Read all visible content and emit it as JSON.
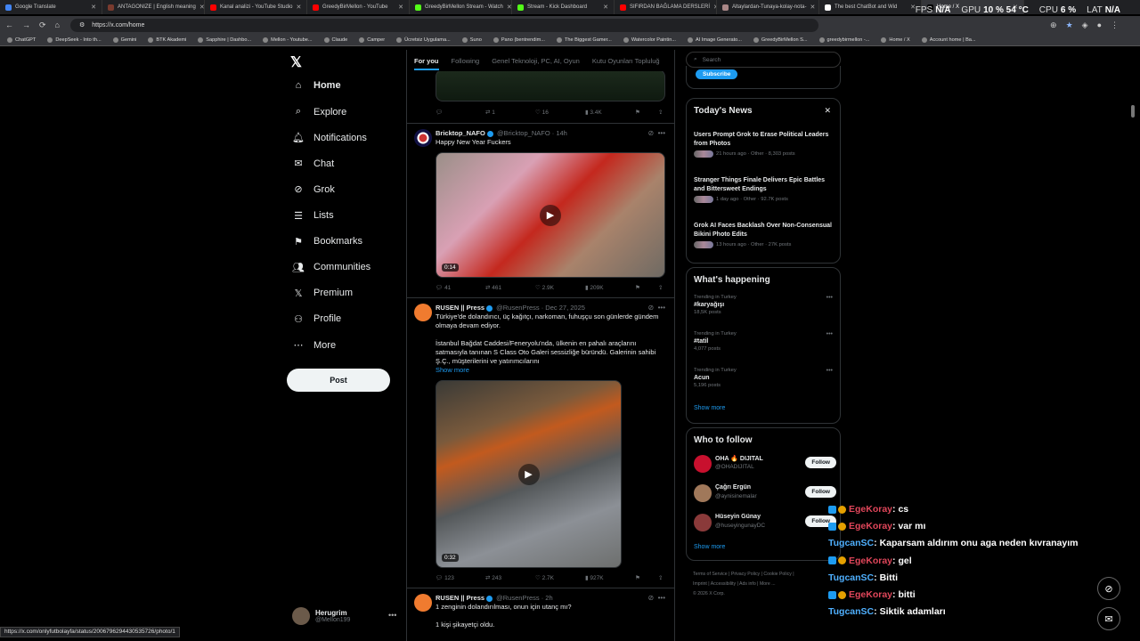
{
  "browser": {
    "tabs": [
      {
        "label": "Google Translate",
        "color": "#4285f4"
      },
      {
        "label": "ANTAGONIZE | English meaning",
        "color": "#7a3b2e"
      },
      {
        "label": "Kanal analizi - YouTube Studio",
        "color": "#ff0000"
      },
      {
        "label": "GreedyBirMellon - YouTube",
        "color": "#ff0000"
      },
      {
        "label": "GreedyBirMellon Stream - Watch",
        "color": "#53fc18"
      },
      {
        "label": "Stream - Kick Dashboard",
        "color": "#53fc18"
      },
      {
        "label": "SIFIRDAN BAĞLAMA DERSLERİ",
        "color": "#ff0000"
      },
      {
        "label": "Altaylardan-Tunaya-kolay-nota-",
        "color": "#a88"
      },
      {
        "label": "The best ChatBot and Wid",
        "color": "#fff"
      },
      {
        "label": "Home / X",
        "color": "#000"
      }
    ],
    "url": "https://x.com/home",
    "bookmarks": [
      "ChatGPT",
      "DeepSeek - Into th...",
      "Gemini",
      "BTK Akademi",
      "Sapphire | Dashbo...",
      "Mellon - Youtube...",
      "Claude",
      "Camper",
      "Ücretsiz Uygulama...",
      "Suno",
      "Pano (bentrendim...",
      "The Biggest Gamer...",
      "Watercolor Paintin...",
      "AI Image Generato...",
      "GreedyBirMellon S...",
      "greedybirmellon -...",
      "Home / X",
      "Account home | Ba..."
    ],
    "status_url": "https://x.com/onlyfutbolayfa/status/2006796294430535726/photo/1"
  },
  "hud": {
    "fps_label": "FPS",
    "fps": "N/A",
    "gpu_label": "GPU",
    "gpu": "10 % 54 °C",
    "cpu_label": "CPU",
    "cpu": "6 %",
    "lat_label": "LAT",
    "lat": "N/A"
  },
  "sidebar": {
    "items": [
      {
        "label": "Home",
        "icon": "home-icon"
      },
      {
        "label": "Explore",
        "icon": "search-icon"
      },
      {
        "label": "Notifications",
        "icon": "bell-icon"
      },
      {
        "label": "Chat",
        "icon": "mail-icon"
      },
      {
        "label": "Grok",
        "icon": "grok-icon"
      },
      {
        "label": "Lists",
        "icon": "list-icon"
      },
      {
        "label": "Bookmarks",
        "icon": "bookmark-icon"
      },
      {
        "label": "Communities",
        "icon": "people-icon"
      },
      {
        "label": "Premium",
        "icon": "x-icon"
      },
      {
        "label": "Profile",
        "icon": "person-icon"
      },
      {
        "label": "More",
        "icon": "more-icon"
      }
    ],
    "post_label": "Post",
    "user_name": "Herugrim",
    "user_handle": "@Mellon199"
  },
  "feed": {
    "tabs": [
      "For you",
      "Following",
      "Genel Teknoloji, PC, AI, Oyun",
      "Kutu Oyunları Topluluğ"
    ],
    "top_actions": {
      "reply": "",
      "repost": "1",
      "like": "16",
      "views": "3.4K"
    },
    "tweets": [
      {
        "name": "Bricktop_NAFO",
        "handle": "@Bricktop_NAFO",
        "time": "· 14h",
        "text": "Happy New Year Fuckers",
        "duration": "0:14",
        "reply": "41",
        "repost": "461",
        "like": "2.9K",
        "views": "209K"
      },
      {
        "name": "RUSEN || Press",
        "handle": "@RusenPress",
        "time": "· Dec 27, 2025",
        "text1": "Türkiye'de dolandırıcı, üç kağıtçı, narkoman, fuhuşçu son günlerde gündem olmaya devam ediyor.",
        "text2": "İstanbul Bağdat Caddesi/Feneryolu'nda, ülkenin en pahalı araçlarını satmasıyla tanınan S Class Oto Galeri sessizliğe büründü. Galerinin sahibi Ş.Ç., müşterilerini ve yatırımcılarını",
        "show_more": "Show more",
        "duration": "0:32",
        "reply": "123",
        "repost": "243",
        "like": "2.7K",
        "views": "927K"
      },
      {
        "name": "RUSEN || Press",
        "handle": "@RusenPress",
        "time": "· 2h",
        "text1": "1 zenginin dolandırılması, onun için utanç mı?",
        "text2": "1 kişi şikayetçi oldu."
      }
    ]
  },
  "right": {
    "search_placeholder": "Search",
    "subscribe_label": "Subscribe",
    "news_title": "Today's News",
    "news": [
      {
        "title": "Users Prompt Grok to Erase Political Leaders from Photos",
        "meta": "21 hours ago · Other · 8,303 posts"
      },
      {
        "title": "Stranger Things Finale Delivers Epic Battles and Bittersweet Endings",
        "meta": "1 day ago · Other · 92.7K posts"
      },
      {
        "title": "Grok AI Faces Backlash Over Non-Consensual Bikini Photo Edits",
        "meta": "13 hours ago · Other · 27K posts"
      }
    ],
    "happening_title": "What's happening",
    "trends": [
      {
        "context": "Trending in Turkey",
        "name": "#karyağışı",
        "posts": "18,5K posts"
      },
      {
        "context": "Trending in Turkey",
        "name": "#tatil",
        "posts": "4,077 posts"
      },
      {
        "context": "Trending in Turkey",
        "name": "Acun",
        "posts": "5,196 posts"
      }
    ],
    "show_more": "Show more",
    "wtf_title": "Who to follow",
    "follow_label": "Follow",
    "suggestions": [
      {
        "name": "OHA 🔥 DIJITAL",
        "handle": "@OHADIJITAL"
      },
      {
        "name": "Çağrı Ergün",
        "handle": "@aynisinemalar"
      },
      {
        "name": "Hüseyin Günay",
        "handle": "@huseyingunayDC"
      }
    ],
    "footer1": "Terms of Service  |  Privacy Policy  |  Cookie Policy  |",
    "footer2": "Imprint  |  Accessibility  |  Ads info  |  More ...",
    "footer3": "© 2026 X Corp."
  },
  "chat": [
    {
      "user": "EgeKoray",
      "msg": ": cs",
      "type": "u1"
    },
    {
      "user": "EgeKoray",
      "msg": ": var mı",
      "type": "u1"
    },
    {
      "user": "TugcanSC",
      "msg": ": Kaparsam aldırım onu aga neden kıvranayım",
      "type": "u2"
    },
    {
      "user": "EgeKoray",
      "msg": ": gel",
      "type": "u1"
    },
    {
      "user": "TugcanSC",
      "msg": ": Bitti",
      "type": "u2"
    },
    {
      "user": "EgeKoray",
      "msg": ": bitti",
      "type": "u1"
    },
    {
      "user": "TugcanSC",
      "msg": ": Siktik adamları",
      "type": "u2"
    }
  ]
}
